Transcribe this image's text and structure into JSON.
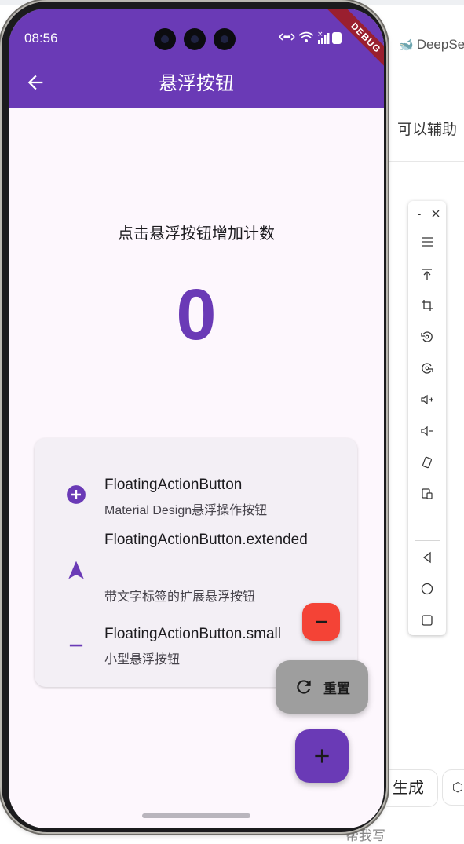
{
  "background": {
    "brand_name": "DeepSe",
    "assist_text": "可以辅助",
    "generate_button": "生成",
    "bottom_hint": "帮我写"
  },
  "status_bar": {
    "time": "08:56",
    "battery": "100",
    "debug_banner": "DEBUG"
  },
  "app_bar": {
    "title": "悬浮按钮",
    "back_icon": "arrow-back-icon",
    "color": "#6a3ab6"
  },
  "main": {
    "instruction": "点击悬浮按钮增加计数",
    "counter": "0"
  },
  "info_card": {
    "items": [
      {
        "icon": "add-circle-icon",
        "title": "FloatingActionButton",
        "subtitle": "Material Design悬浮操作按钮"
      },
      {
        "icon": "navigation-icon",
        "title": "FloatingActionButton.extended",
        "subtitle": "带文字标签的扩展悬浮按钮"
      },
      {
        "icon": "remove-icon",
        "title": "FloatingActionButton.small",
        "subtitle": "小型悬浮按钮"
      }
    ]
  },
  "fabs": {
    "small": {
      "icon": "remove-icon",
      "color": "#f44336"
    },
    "extended": {
      "icon": "refresh-icon",
      "label": "重置",
      "color": "#9e9e9e"
    },
    "primary": {
      "icon": "add-icon",
      "color": "#6a3ab6"
    }
  },
  "emulator_toolbar": {
    "minimize_label": "-",
    "buttons": [
      "menu-icon",
      "pin-top-icon",
      "screenshot-crop-icon",
      "rotate-left-icon",
      "rotate-right-icon",
      "volume-up-icon",
      "volume-down-icon",
      "shake-icon",
      "fold-icon",
      "back-nav-icon",
      "home-nav-icon",
      "overview-nav-icon"
    ]
  }
}
